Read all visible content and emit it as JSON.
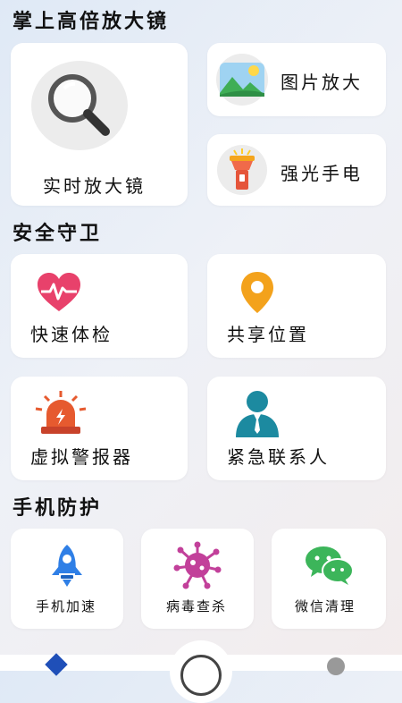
{
  "header": {
    "title": "掌上高倍放大镜"
  },
  "top": {
    "magnifier_label": "实时放大镜",
    "photo_label": "图片放大",
    "flashlight_label": "强光手电"
  },
  "safety": {
    "title": "安全守卫",
    "items": [
      {
        "label": "快速体检",
        "icon": "heart-rate-icon"
      },
      {
        "label": "共享位置",
        "icon": "location-pin-icon"
      },
      {
        "label": "虚拟警报器",
        "icon": "alarm-siren-icon"
      },
      {
        "label": "紧急联系人",
        "icon": "contact-person-icon"
      }
    ]
  },
  "phone": {
    "title": "手机防护",
    "items": [
      {
        "label": "手机加速",
        "icon": "rocket-icon"
      },
      {
        "label": "病毒查杀",
        "icon": "virus-icon"
      },
      {
        "label": "微信清理",
        "icon": "wechat-icon"
      }
    ]
  },
  "colors": {
    "heart": "#e8416b",
    "pin": "#f3a21c",
    "siren": "#e65a2f",
    "rocket": "#2f7fe6",
    "virus": "#c2409a",
    "wechat": "#3cb55a",
    "contact": "#1c8aa0"
  }
}
